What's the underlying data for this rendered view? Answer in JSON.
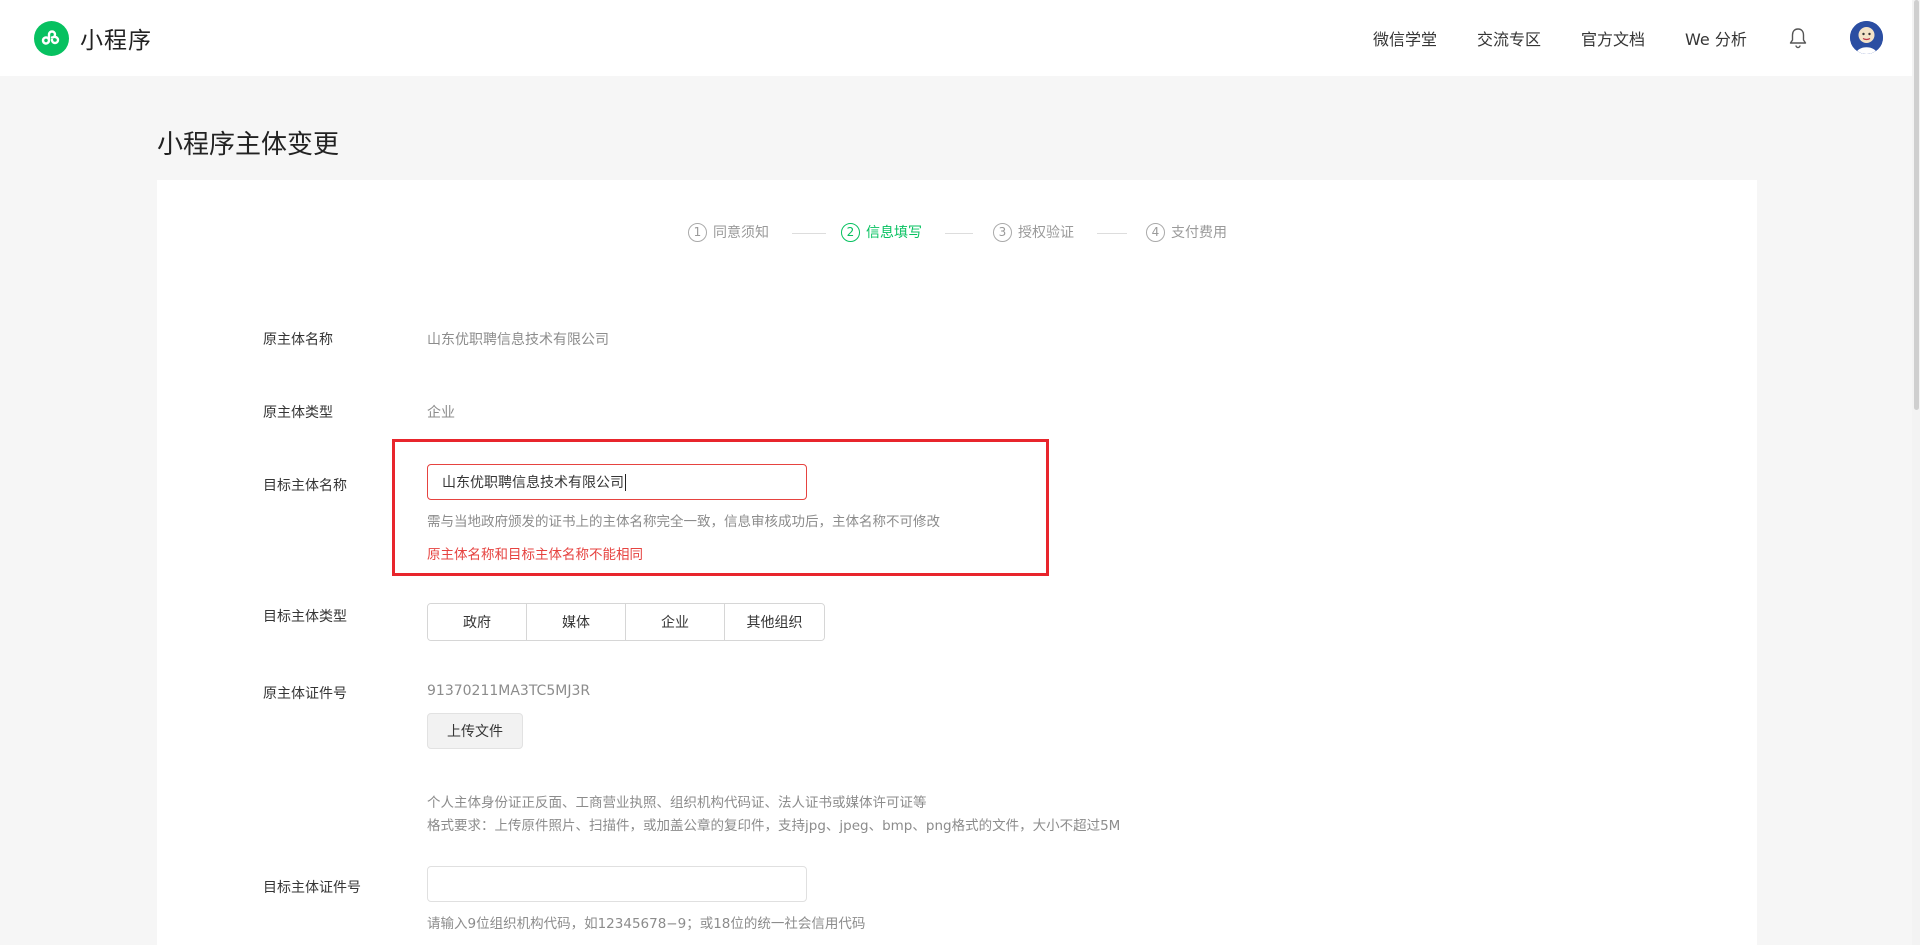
{
  "header": {
    "brand": "小程序",
    "nav": [
      "微信学堂",
      "交流专区",
      "官方文档",
      "We 分析"
    ],
    "icons": [
      "bell-icon",
      "avatar"
    ]
  },
  "page": {
    "title": "小程序主体变更"
  },
  "steps": [
    {
      "num": "1",
      "label": "同意须知",
      "active": false
    },
    {
      "num": "2",
      "label": "信息填写",
      "active": true
    },
    {
      "num": "3",
      "label": "授权验证",
      "active": false
    },
    {
      "num": "4",
      "label": "支付费用",
      "active": false
    }
  ],
  "form": {
    "original_name": {
      "label": "原主体名称",
      "value": "山东优职聘信息技术有限公司"
    },
    "original_type": {
      "label": "原主体类型",
      "value": "企业"
    },
    "target_name": {
      "label": "目标主体名称",
      "value": "山东优职聘信息技术有限公司",
      "hint": "需与当地政府颁发的证书上的主体名称完全一致，信息审核成功后，主体名称不可修改",
      "error": "原主体名称和目标主体名称不能相同"
    },
    "target_type": {
      "label": "目标主体类型",
      "options": [
        "政府",
        "媒体",
        "企业",
        "其他组织"
      ]
    },
    "original_cert": {
      "label": "原主体证件号",
      "value": "91370211MA3TC5MJ3R",
      "upload_label": "上传文件",
      "hint1": "个人主体身份证正反面、工商营业执照、组织机构代码证、法人证书或媒体许可证等",
      "hint2": "格式要求：上传原件照片、扫描件，或加盖公章的复印件，支持jpg、jpeg、bmp、png格式的文件，大小不超过5M"
    },
    "target_cert": {
      "label": "目标主体证件号",
      "value": "",
      "hint": "请输入9位组织机构代码，如12345678−9；或18位的统一社会信用代码"
    }
  },
  "colors": {
    "accent": "#07c160",
    "error": "#e64340",
    "highlight": "#e8252c"
  }
}
